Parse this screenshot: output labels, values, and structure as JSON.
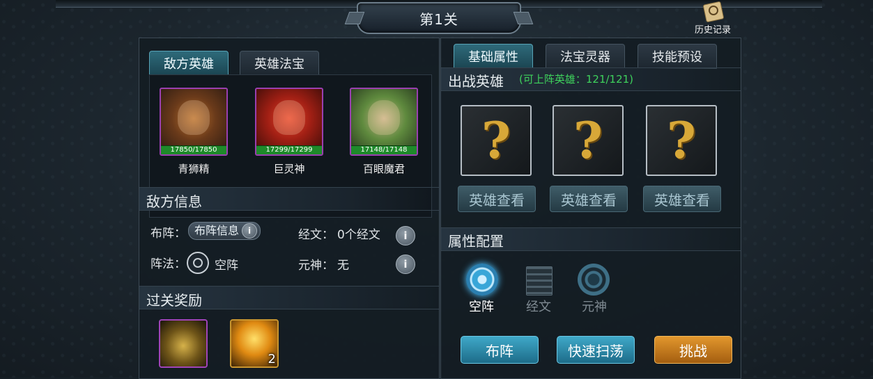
{
  "header": {
    "level_title": "第1关",
    "history_label": "历史记录"
  },
  "left": {
    "tabs": [
      {
        "label": "敌方英雄",
        "active": true
      },
      {
        "label": "英雄法宝",
        "active": false
      }
    ],
    "heroes": [
      {
        "name": "青狮精",
        "hp": "17850/17850"
      },
      {
        "name": "巨灵神",
        "hp": "17299/17299"
      },
      {
        "name": "百眼魔君",
        "hp": "17148/17148"
      }
    ],
    "enemy_info": {
      "title": "敌方信息",
      "formation_label": "布阵：",
      "formation_button": "布阵信息",
      "scripture_label": "经文：",
      "scripture_value": "0个经文",
      "array_label": "阵法：",
      "array_value": "空阵",
      "spirit_label": "元神：",
      "spirit_value": "无"
    },
    "rewards": {
      "title": "过关奖励",
      "items": [
        {
          "icon": "gold-coins"
        },
        {
          "icon": "golden-orb",
          "count": "2"
        }
      ]
    }
  },
  "right": {
    "tabs": [
      {
        "label": "基础属性",
        "active": true
      },
      {
        "label": "法宝灵器",
        "active": false
      },
      {
        "label": "技能预设",
        "active": false
      }
    ],
    "battle_heroes": {
      "title": "出战英雄",
      "note": "(可上阵英雄：121/121)"
    },
    "slots": [
      {
        "mark": "?",
        "view_label": "英雄查看"
      },
      {
        "mark": "?",
        "view_label": "英雄查看"
      },
      {
        "mark": "?",
        "view_label": "英雄查看"
      }
    ],
    "attr_config": {
      "title": "属性配置",
      "options": [
        {
          "label": "空阵",
          "active": true
        },
        {
          "label": "经文",
          "active": false
        },
        {
          "label": "元神",
          "active": false
        }
      ]
    },
    "actions": {
      "formation": "布阵",
      "sweep": "快速扫荡",
      "challenge": "挑战"
    }
  },
  "colors": {
    "accent_blue": "#3fa8c8",
    "challenge_orange": "#e2972d",
    "hp_green": "#1e8a2a",
    "note_green": "#3ed15c"
  }
}
